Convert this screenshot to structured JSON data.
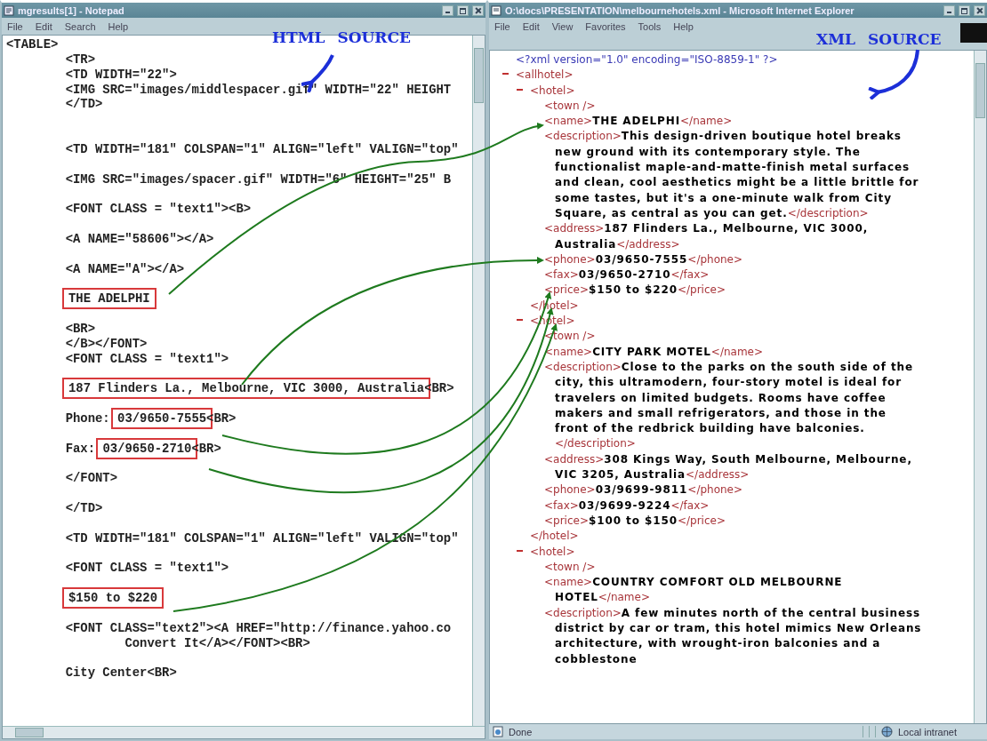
{
  "notepad": {
    "title": "mgresults[1] - Notepad",
    "menu": [
      "File",
      "Edit",
      "Search",
      "Help"
    ],
    "blocks": [
      [
        [
          {
            "text": "<TABLE>",
            "boxed": false
          }
        ],
        [
          {
            "text": "\t<TR>",
            "boxed": false
          }
        ],
        [
          {
            "text": "\t<TD WIDTH=\"22\">",
            "boxed": false
          }
        ],
        [
          {
            "text": "\t<IMG SRC=\"images/middlespacer.gif\" WIDTH=\"22\" HEIGHT",
            "boxed": false
          }
        ],
        [
          {
            "text": "\t</TD>",
            "boxed": false
          }
        ]
      ],
      [
        [
          {
            "text": "\t<TD WIDTH=\"181\" COLSPAN=\"1\" ALIGN=\"left\" VALIGN=\"top\"",
            "boxed": false
          }
        ]
      ],
      [
        [
          {
            "text": "\t<IMG SRC=\"images/spacer.gif\" WIDTH=\"6\" HEIGHT=\"25\" B",
            "boxed": false
          }
        ]
      ],
      [
        [
          {
            "text": "\t<FONT CLASS = \"text1\"><B>",
            "boxed": false
          }
        ]
      ],
      [
        [
          {
            "text": "\t<A NAME=\"58606\"></A>",
            "boxed": false
          }
        ]
      ],
      [
        [
          {
            "text": "\t<A NAME=\"A\"></A>",
            "boxed": false
          }
        ]
      ],
      [
        [
          {
            "text": "THE ADELPHI",
            "boxed": true
          }
        ]
      ],
      [
        [
          {
            "text": "\t<BR>",
            "boxed": false
          }
        ],
        [
          {
            "text": "\t</B></FONT>",
            "boxed": false
          }
        ],
        [
          {
            "text": "\t<FONT CLASS = \"text1\">",
            "boxed": false
          }
        ]
      ],
      [
        [
          {
            "text": "187 Flinders La., Melbourne, VIC 3000, Australia",
            "boxed": true
          },
          {
            "text": "<BR>",
            "boxed": false
          }
        ]
      ],
      [
        [
          {
            "text": "\tPhone: ",
            "boxed": false
          },
          {
            "text": "03/9650-7555",
            "boxed": true
          },
          {
            "text": "<BR>",
            "boxed": false
          }
        ]
      ],
      [
        [
          {
            "text": "\tFax: ",
            "boxed": false
          },
          {
            "text": "03/9650-2710",
            "boxed": true
          },
          {
            "text": "<BR>",
            "boxed": false
          }
        ]
      ],
      [
        [
          {
            "text": "\t</FONT>",
            "boxed": false
          }
        ]
      ],
      [
        [
          {
            "text": "\t</TD>",
            "boxed": false
          }
        ]
      ],
      [
        [
          {
            "text": "\t<TD WIDTH=\"181\" COLSPAN=\"1\" ALIGN=\"left\" VALIGN=\"top\"",
            "boxed": false
          }
        ]
      ],
      [
        [
          {
            "text": "\t<FONT CLASS = \"text1\">",
            "boxed": false
          }
        ]
      ],
      [
        [
          {
            "text": "$150 to $220",
            "boxed": true
          }
        ]
      ],
      [
        [
          {
            "text": "\t<FONT CLASS=\"text2\"><A HREF=\"http://finance.yahoo.co",
            "boxed": false
          }
        ],
        [
          {
            "text": "\t\tConvert It</A></FONT><BR>",
            "boxed": false
          }
        ]
      ],
      [
        [
          {
            "text": "\tCity Center<BR>",
            "boxed": false
          }
        ]
      ]
    ]
  },
  "browser": {
    "title": "O:\\docs\\PRESENTATION\\melbournehotels.xml - Microsoft Internet Explorer",
    "menu": [
      "File",
      "Edit",
      "View",
      "Favorites",
      "Tools",
      "Help"
    ],
    "xml": {
      "declaration": "<?xml version=\"1.0\" encoding=\"ISO-8859-1\" ?>",
      "root": {
        "open": "<allhotel>",
        "expanded": true,
        "children": [
          {
            "open": "<hotel>",
            "expanded": true,
            "close": "</hotel>",
            "children": [
              {
                "open": "<town />"
              },
              {
                "open": "<name>",
                "value": "THE ADELPHI",
                "close": "</name>"
              },
              {
                "open": "<description>",
                "value": "This design-driven boutique hotel breaks new ground with its contemporary style. The functionalist maple-and-matte-finish metal surfaces and clean, cool aesthetics might be a little brittle for some tastes, but it's a one-minute walk from City Square, as central as you can get.",
                "close": "</description>"
              },
              {
                "open": "<address>",
                "value": "187 Flinders La., Melbourne, VIC 3000, Australia",
                "close": "</address>"
              },
              {
                "open": "<phone>",
                "value": "03/9650-7555",
                "close": "</phone>"
              },
              {
                "open": "<fax>",
                "value": "03/9650-2710",
                "close": "</fax>"
              },
              {
                "open": "<price>",
                "value": "$150 to $220",
                "close": "</price>"
              }
            ]
          },
          {
            "open": "<hotel>",
            "expanded": true,
            "close": "</hotel>",
            "children": [
              {
                "open": "<town />"
              },
              {
                "open": "<name>",
                "value": "CITY PARK MOTEL",
                "close": "</name>"
              },
              {
                "open": "<description>",
                "value": "Close to the parks on the south side of the city, this ultramodern, four-story motel is ideal for travelers on limited budgets. Rooms have coffee makers and small refrigerators, and those in the front of the redbrick building have balconies.",
                "close": "</description>"
              },
              {
                "open": "<address>",
                "value": "308 Kings Way, South Melbourne, Melbourne, VIC 3205, Australia",
                "close": "</address>"
              },
              {
                "open": "<phone>",
                "value": "03/9699-9811",
                "close": "</phone>"
              },
              {
                "open": "<fax>",
                "value": "03/9699-9224",
                "close": "</fax>"
              },
              {
                "open": "<price>",
                "value": "$100 to $150",
                "close": "</price>"
              }
            ]
          },
          {
            "open": "<hotel>",
            "expanded": true,
            "children": [
              {
                "open": "<town />"
              },
              {
                "open": "<name>",
                "value": "COUNTRY COMFORT OLD MELBOURNE HOTEL",
                "close": "</name>"
              },
              {
                "open": "<description>",
                "value": "A few minutes north of the central business district by car or tram, this hotel mimics New Orleans architecture, with wrought-iron balconies and a cobblestone"
              }
            ]
          }
        ]
      }
    },
    "status": "Done",
    "zone": "Local intranet"
  },
  "annotations": [
    "HTML SOURCE",
    "XML SOURCE"
  ]
}
